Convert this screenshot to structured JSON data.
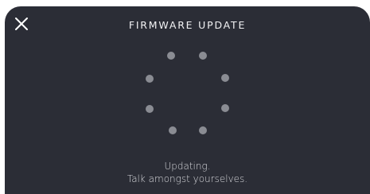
{
  "dialog": {
    "title": "FIRMWARE UPDATE",
    "close_icon": "close-icon",
    "spinner_icon": "loading-spinner-icon",
    "status_line1": "Updating.",
    "status_line2": "Talk amongst yourselves."
  },
  "colors": {
    "background": "#2b2d36",
    "text": "#ffffff",
    "dot": "#8a8c93"
  }
}
